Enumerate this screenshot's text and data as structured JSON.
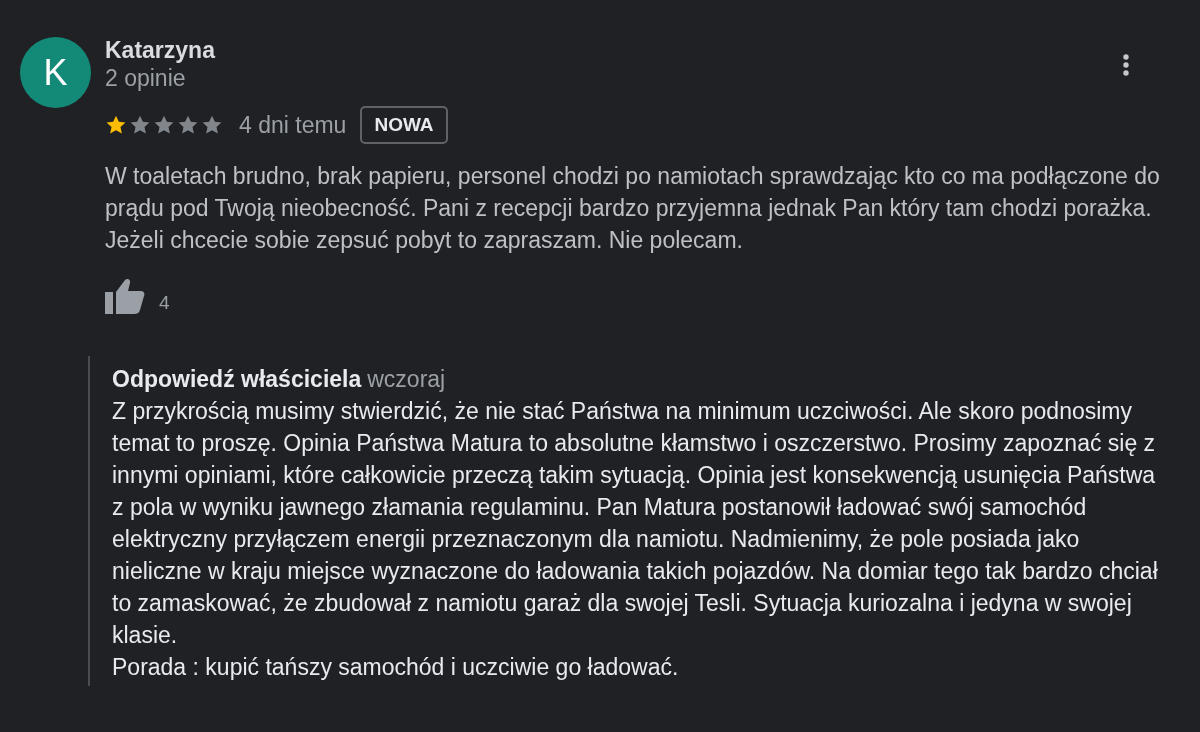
{
  "review": {
    "author": {
      "initial": "K",
      "name": "Katarzyna",
      "review_count": "2 opinie"
    },
    "stars": 1,
    "date": "4 dni temu",
    "badge": "NOWA",
    "text": "W toaletach brudno, brak papieru, personel chodzi po namiotach sprawdzając kto co ma podłączone do prądu pod Twoją nieobecność. Pani z recepcji bardzo przyjemna jednak Pan który tam chodzi porażka. Jeżeli chcecie sobie zepsuć pobyt to zapraszam. Nie polecam.",
    "likes": "4"
  },
  "owner_reply": {
    "label": "Odpowiedź właściciela",
    "date": "wczoraj",
    "paragraphs": [
      "Z przykrością musimy stwierdzić, że nie stać Państwa na minimum uczciwości. Ale skoro podnosimy temat to proszę. Opinia Państwa Matura to absolutne kłamstwo i oszczerstwo. Prosimy zapoznać się z innymi opiniami, które całkowicie przeczą takim sytuacją. Opinia jest konsekwencją usunięcia Państwa z pola w wyniku jawnego złamania regulaminu. Pan Matura postanowił ładować swój samochód elektryczny przyłączem energii przeznaczonym dla namiotu. Nadmienimy, że pole posiada jako nieliczne w kraju miejsce wyznaczone do ładowania takich pojazdów. Na domiar tego tak bardzo chciał to zamaskować, że zbudował z namiotu garaż dla swojej Tesli. Sytuacja kuriozalna i jedyna w swojej klasie.",
      "Porada : kupić tańszy samochód i uczciwie go ładować."
    ]
  }
}
